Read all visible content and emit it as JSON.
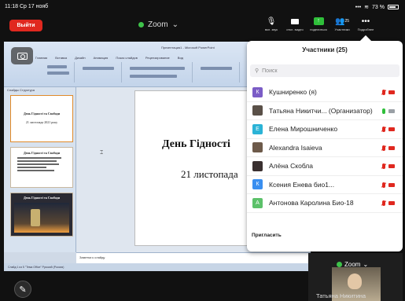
{
  "status": {
    "time": "11:18",
    "date": "Ср 17 нояб",
    "signal": "•••",
    "battery": "73 %"
  },
  "topbar": {
    "leave_label": "Выйти",
    "title": "Zoom",
    "tools": [
      {
        "icon": "mic-muted-icon",
        "label": "вкл. звук"
      },
      {
        "icon": "video-icon",
        "label": "откл. видео"
      },
      {
        "icon": "share-screen-icon",
        "label": "поделиться"
      },
      {
        "icon": "participants-icon",
        "label": "Участники",
        "count": "25"
      },
      {
        "icon": "more-icon",
        "label": "Подробнее"
      }
    ]
  },
  "presentation": {
    "app_title": "Презентация1 - Microsoft PowerPoint",
    "tabs": [
      "Главная",
      "Вставка",
      "Дизайн",
      "Анимация",
      "Показ слайдов",
      "Рецензирование",
      "Вид"
    ],
    "panel_tabs": "Слайды   Структура",
    "thumbnails": [
      {
        "title": "День Гідності та Свободи",
        "sub": "21 листопада 2021 року"
      },
      {
        "title": "День Гідності та Свободи"
      },
      {
        "title": "День Гідності та Свободи"
      }
    ],
    "slide_title": "День Гідності",
    "slide_subtitle": "21 листопада",
    "notes": "Заметки к слайду",
    "statusline": "Слайд 1 из 5   \"Тема Office\"   Русский (Россия)"
  },
  "participants": {
    "title": "Участники (25)",
    "search_placeholder": "Поиск",
    "items": [
      {
        "name": "Кушниренко (я)",
        "initial": "К",
        "color": "#7b5cc6",
        "mic": "off",
        "video": "off"
      },
      {
        "name": "Татьяна Никитчи... (Организатор)",
        "initial": "",
        "color": "#5a5048",
        "mic": "on",
        "video": "on"
      },
      {
        "name": "Елена Мирошниченко",
        "initial": "Е",
        "color": "#2bb3d6",
        "mic": "off",
        "video": "off"
      },
      {
        "name": "Alexandra Isaieva",
        "initial": "",
        "color": "#6d5a4a",
        "mic": "off",
        "video": "off"
      },
      {
        "name": "Алёна Скобла",
        "initial": "",
        "color": "#3a3030",
        "mic": "off",
        "video": "off"
      },
      {
        "name": "Ксения Енева био1...",
        "initial": "К",
        "color": "#3a8ff0",
        "mic": "off",
        "video": "off"
      },
      {
        "name": "Антонова Каролина Био-18",
        "initial": "А",
        "color": "#5cc16a",
        "mic": "off",
        "video": "off"
      }
    ],
    "invite_label": "Пригласить"
  },
  "self_video": {
    "zoom_label": "Zoom",
    "name": "Татьяна Никитина"
  },
  "colors": {
    "leave": "#e0281f",
    "active_mic": "#2fbf3a",
    "muted": "#e0281f"
  }
}
